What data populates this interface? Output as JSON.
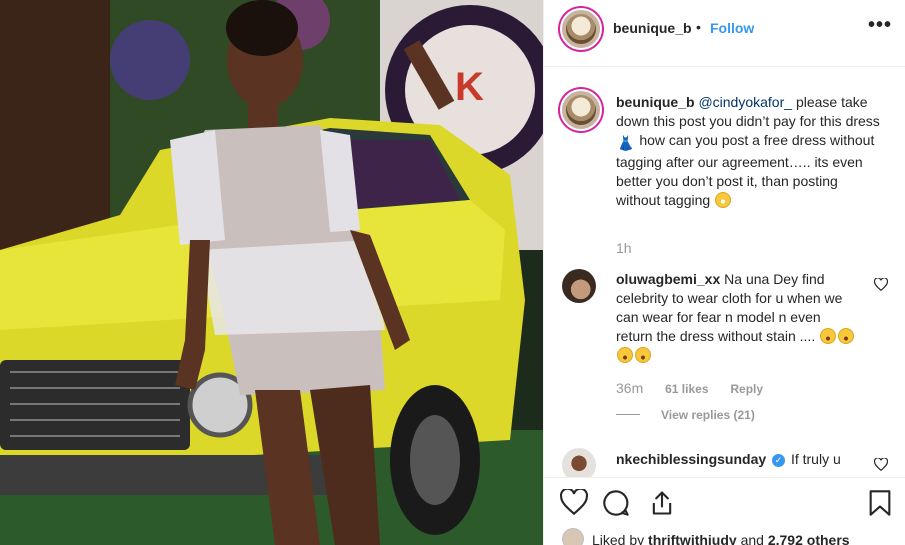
{
  "post": {
    "username": "beunique_b",
    "dot": "•",
    "follow_label": "Follow",
    "more_label": "•••",
    "photo_description": "Woman in sequined fringe dress leaning on yellow vintage car"
  },
  "caption": {
    "username": "beunique_b",
    "mention": "@cindyokafor_",
    "text_1": "please take down this post you didn’t pay for this dress",
    "text_2": "how can you post a free dress without tagging after our agreement….. its even better you don’t post it, than posting without tagging",
    "time": "1h"
  },
  "comments": [
    {
      "username": "oluwagbemi_xx",
      "text": "Na una Dey find celebrity to wear cloth for u when we can wear for fear n model n even return the dress without stain ....",
      "time": "36m",
      "likes": "61 likes",
      "reply_label": "Reply",
      "view_replies": "View replies (21)"
    },
    {
      "username": "nkechiblessingsunday",
      "verified": "✓",
      "text": "If truly u"
    }
  ],
  "liked": {
    "prefix": "Liked by",
    "user": "thriftwithjudy",
    "and": "and",
    "others": "2,792 others"
  },
  "colors": {
    "accent": "#3897f0",
    "car_yellow": "#e3e02c",
    "text": "#262626",
    "muted": "#999999"
  },
  "icons": [
    "heart-icon",
    "comment-icon",
    "share-icon",
    "bookmark-icon",
    "more-icon"
  ]
}
